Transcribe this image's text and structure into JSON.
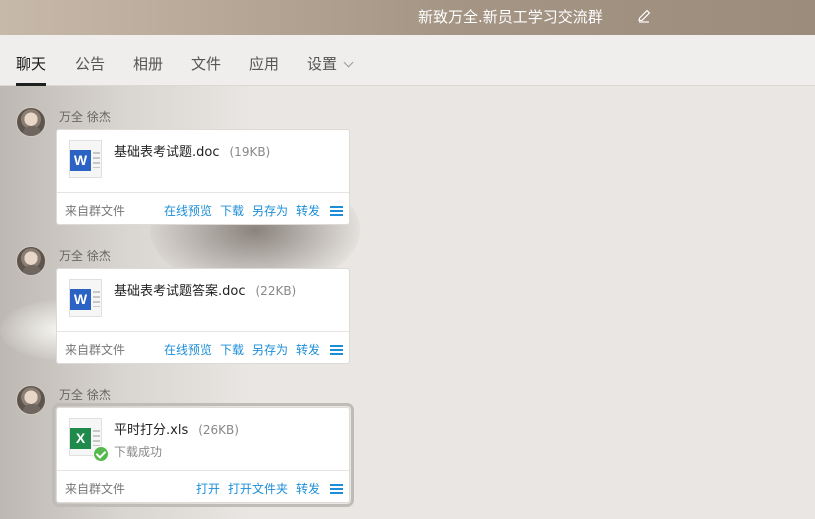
{
  "header": {
    "title": "新致万全.新员工学习交流群"
  },
  "tabs": [
    {
      "label": "聊天",
      "active": true
    },
    {
      "label": "公告"
    },
    {
      "label": "相册"
    },
    {
      "label": "文件"
    },
    {
      "label": "应用"
    },
    {
      "label": "设置"
    }
  ],
  "messages": [
    {
      "sender": "万全 徐杰",
      "file": {
        "name": "基础表考试题.doc",
        "size": "(19KB)",
        "type": "word"
      },
      "source": "来自群文件",
      "actions": [
        "在线预览",
        "下载",
        "另存为",
        "转发"
      ]
    },
    {
      "sender": "万全 徐杰",
      "file": {
        "name": "基础表考试题答案.doc",
        "size": "(22KB)",
        "type": "word"
      },
      "source": "来自群文件",
      "actions": [
        "在线预览",
        "下载",
        "另存为",
        "转发"
      ]
    },
    {
      "sender": "万全 徐杰",
      "file": {
        "name": "平时打分.xls",
        "size": "(26KB)",
        "type": "excel",
        "status": "下载成功"
      },
      "source": "来自群文件",
      "actions": [
        "打开",
        "打开文件夹",
        "转发"
      ]
    }
  ],
  "icons": {
    "word_badge": "W",
    "excel_badge": "X"
  },
  "colors": {
    "link": "#1c8ed8",
    "word": "#2b63c4",
    "excel": "#1f8a4c",
    "success": "#55b94b"
  }
}
